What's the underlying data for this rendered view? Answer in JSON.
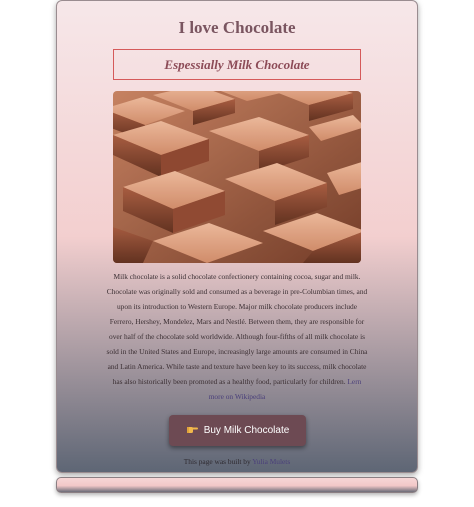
{
  "header": {
    "title": "I love Chocolate",
    "subtitle": "Espessially Milk Chocolate"
  },
  "hero": {
    "image_alt": "milk chocolate bar"
  },
  "description": {
    "text": "Milk chocolate is a solid chocolate confectionery containing cocoa, sugar and milk. Chocolate was originally sold and consumed as a beverage in pre-Columbian times, and upon its introduction to Western Europe. Major milk chocolate producers include Ferrero, Hershey, Mondelez, Mars and Nestlé. Between them, they are responsible for over half of the chocolate sold worldwide. Although four-fifths of all milk chocolate is sold in the United States and Europe, increasingly large amounts are consumed in China and Latin America. While taste and texture have been key to its success, milk chocolate has also historically been promoted as a healthy food, particularly for children.",
    "link_label": "Lern more on Wikipedia"
  },
  "buy_button": {
    "icon": "pointing-hand-icon",
    "label": "Buy Milk Chocolate"
  },
  "footer": {
    "credit_prefix": "This page was built by",
    "author_link": "Yulia Mulets"
  },
  "colors": {
    "title": "#7a5560",
    "subtitle": "#8c4b57",
    "subtitle_border": "#d55a5a",
    "button_bg": "#6d4a53",
    "link": "#4a3f7a"
  }
}
